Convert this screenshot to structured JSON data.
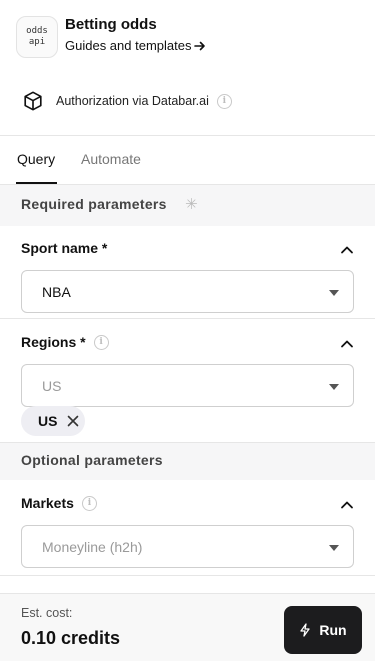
{
  "header": {
    "logo_text": "odds\napi",
    "title": "Betting odds",
    "guides_link": "Guides and templates"
  },
  "auth": {
    "text": "Authorization via Databar.ai"
  },
  "tabs": [
    {
      "label": "Query",
      "active": true
    },
    {
      "label": "Automate",
      "active": false
    }
  ],
  "required_section": {
    "title": "Required parameters",
    "fields": [
      {
        "label": "Sport name *",
        "value": "NBA"
      },
      {
        "label": "Regions *",
        "placeholder": "US",
        "chips": [
          "US"
        ]
      }
    ]
  },
  "optional_section": {
    "title": "Optional parameters",
    "fields": [
      {
        "label": "Markets",
        "placeholder": "Moneyline (h2h)"
      }
    ]
  },
  "footer": {
    "cost_label": "Est. cost:",
    "cost_value": "0.10 credits",
    "run_label": "Run"
  },
  "colors": {
    "primary_button": "#1c1c1e",
    "section_band": "#f6f6f7",
    "chip_bg": "#eeeef3"
  }
}
